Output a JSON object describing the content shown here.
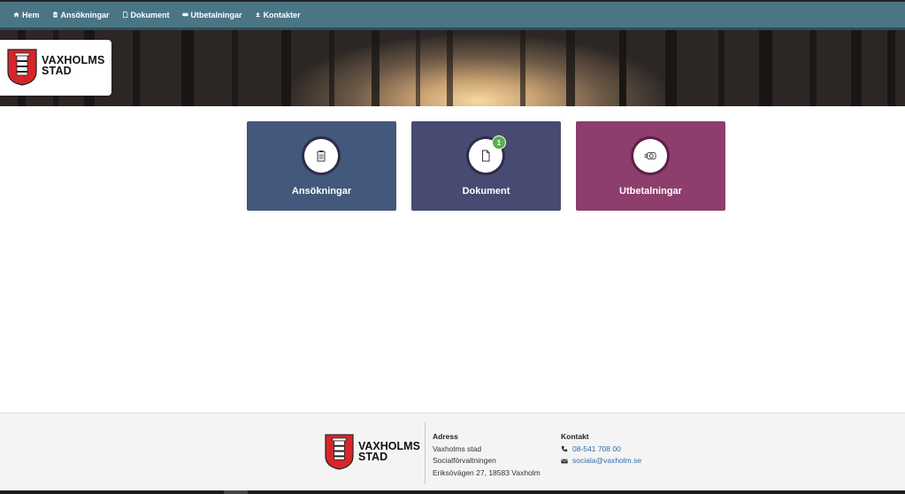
{
  "nav": {
    "items": [
      {
        "label": "Hem",
        "icon": "home-icon"
      },
      {
        "label": "Ansökningar",
        "icon": "clipboard-icon"
      },
      {
        "label": "Dokument",
        "icon": "document-icon"
      },
      {
        "label": "Utbetalningar",
        "icon": "money-icon"
      },
      {
        "label": "Kontakter",
        "icon": "contacts-icon"
      }
    ]
  },
  "logo": {
    "line1": "VAXHOLMS",
    "line2": "STAD"
  },
  "cards": [
    {
      "label": "Ansökningar",
      "icon": "clipboard-icon",
      "color": "#43587a",
      "badge": null
    },
    {
      "label": "Dokument",
      "icon": "document-icon",
      "color": "#474b72",
      "badge": "1"
    },
    {
      "label": "Utbetalningar",
      "icon": "money-icon",
      "color": "#8d3e6c",
      "badge": null
    }
  ],
  "footer": {
    "logo": {
      "line1": "VAXHOLMS",
      "line2": "STAD"
    },
    "address": {
      "heading": "Adress",
      "lines": [
        "Vaxholms stad",
        "Socialförvaltningen",
        "Eriksövägen 27, 18583 Vaxholm"
      ]
    },
    "contact": {
      "heading": "Kontakt",
      "phone": "08-541 708 00",
      "email": "sociala@vaxholm.se"
    }
  },
  "colors": {
    "nav": "#4a7585",
    "badge": "#5aae4f",
    "link": "#2f6ea8"
  }
}
